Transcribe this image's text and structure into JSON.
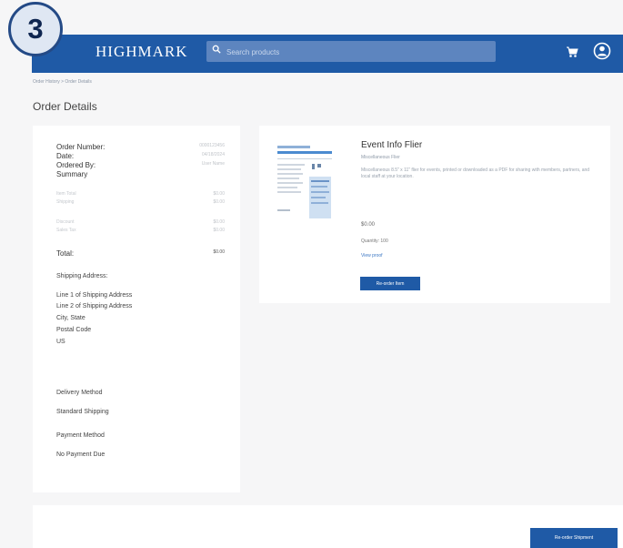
{
  "step_badge": "3",
  "header": {
    "logo": "HIGHMARK",
    "search_placeholder": "Search products"
  },
  "breadcrumb": "Order History > Order Details",
  "page_title": "Order Details",
  "summary": {
    "order_number_label": "Order Number:",
    "order_number_value": "0000123456",
    "date_label": "Date:",
    "date_value": "04/18/2024",
    "ordered_by_label": "Ordered By:",
    "ordered_by_value": "User Name",
    "summary_label": "Summary",
    "subtotal_label": "Item Total",
    "subtotal_value": "$0.00",
    "shipping_label": "Shipping",
    "shipping_value": "$0.00",
    "discount_label": "Discount",
    "discount_value": "$0.00",
    "tax_label": "Sales Tax",
    "tax_value": "$0.00",
    "total_label": "Total:",
    "total_value": "$0.00",
    "shipping_address_label": "Shipping Address:",
    "address_lines": [
      "Line 1 of Shipping Address",
      "Line 2 of Shipping Address",
      "City, State",
      "Postal Code",
      "US"
    ],
    "delivery_method_label": "Delivery Method",
    "delivery_method_value": "Standard Shipping",
    "payment_method_label": "Payment Method",
    "payment_method_value": "No Payment Due"
  },
  "product": {
    "name": "Event Info Flier",
    "sub": "Miscellaneous Flier",
    "description": "Miscellaneous 8.5\" x 11\" flier for events, printed or downloaded as a PDF for sharing with members, partners, and local staff at your location.",
    "price": "$0.00",
    "quantity": "Quantity: 100",
    "link": "View proof",
    "reorder_button": "Re-order Item"
  },
  "reorder_all_button": "Re-order Shipment",
  "colors": {
    "brand_blue": "#1f5aa6",
    "badge_border": "#244a86",
    "page_bg": "#f6f6f7"
  },
  "icons": {
    "search": "search-icon",
    "cart": "cart-icon",
    "user": "user-icon"
  }
}
